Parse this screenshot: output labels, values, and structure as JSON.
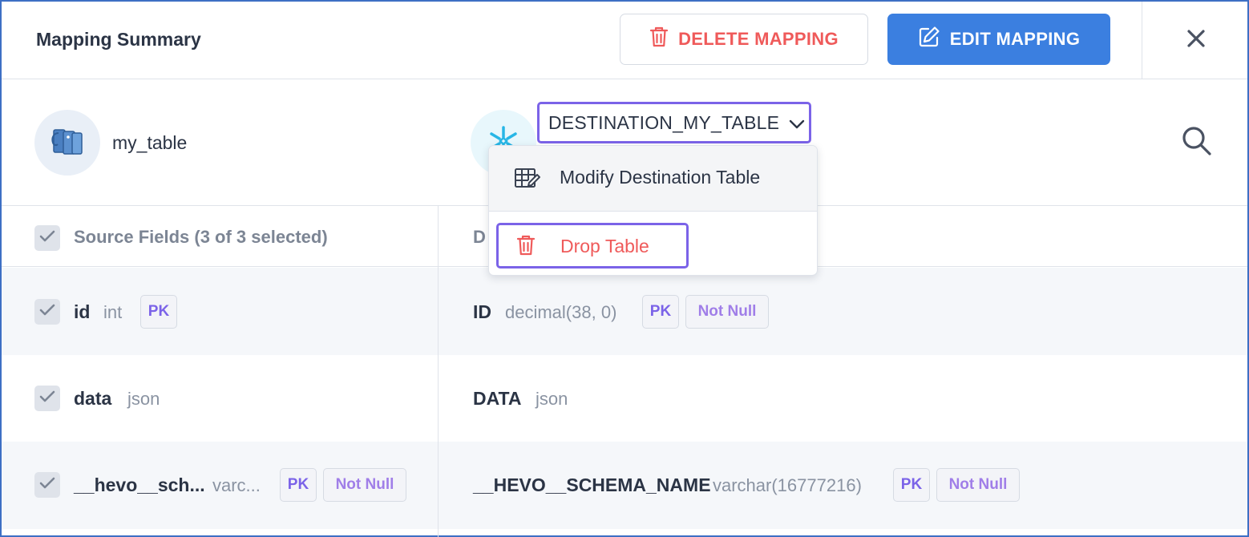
{
  "header": {
    "title": "Mapping Summary",
    "delete_label": "DELETE MAPPING",
    "edit_label": "EDIT MAPPING",
    "close_icon": "close-icon"
  },
  "source": {
    "icon": "postgres-elephant-icon",
    "table_name": "my_table"
  },
  "destination": {
    "icon": "snowflake-icon",
    "selected_table": "DESTINATION_MY_TABLE"
  },
  "dropdown_menu": {
    "items": [
      {
        "label": "Modify Destination Table",
        "icon": "table-edit-icon"
      },
      {
        "label": "Drop Table",
        "icon": "trash-icon"
      }
    ]
  },
  "fields_header": {
    "source_label": "Source Fields (3 of 3 selected)",
    "dest_label_visible": "D"
  },
  "rows": [
    {
      "src_name": "id",
      "src_type": "int",
      "src_badges": [
        "PK"
      ],
      "dst_name": "ID",
      "dst_type": "decimal(38, 0)",
      "dst_badges": [
        "PK",
        "Not Null"
      ]
    },
    {
      "src_name": "data",
      "src_type": "json",
      "src_badges": [],
      "dst_name": "DATA",
      "dst_type": "json",
      "dst_badges": []
    },
    {
      "src_name": "__hevo__sch...",
      "src_type": "varc...",
      "src_badges": [
        "PK",
        "Not Null"
      ],
      "dst_name": "__HEVO__SCHEMA_NAME",
      "dst_type": "varchar(16777216)",
      "dst_badges": [
        "PK",
        "Not Null"
      ]
    }
  ],
  "colors": {
    "primary": "#3b7fe0",
    "danger": "#ef5a5a",
    "focus_outline": "#7b63e8",
    "badge_text": "#7b63e8"
  }
}
